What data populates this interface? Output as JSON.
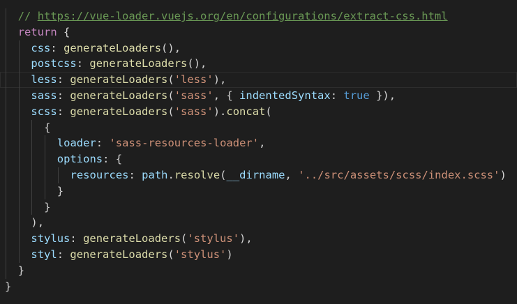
{
  "editor": {
    "lines": [
      {
        "indent": 1,
        "current": false,
        "tokens": [
          {
            "t": "// ",
            "c": "comment"
          },
          {
            "t": "https://vue-loader.vuejs.org/en/configurations/extract-css.html",
            "c": "link"
          }
        ]
      },
      {
        "indent": 1,
        "current": false,
        "tokens": [
          {
            "t": "return",
            "c": "keyword"
          },
          {
            "t": " {",
            "c": "punc"
          }
        ]
      },
      {
        "indent": 2,
        "current": false,
        "tokens": [
          {
            "t": "css",
            "c": "prop"
          },
          {
            "t": ": ",
            "c": "punc"
          },
          {
            "t": "generateLoaders",
            "c": "func"
          },
          {
            "t": "(),",
            "c": "punc"
          }
        ]
      },
      {
        "indent": 2,
        "current": false,
        "tokens": [
          {
            "t": "postcss",
            "c": "prop"
          },
          {
            "t": ": ",
            "c": "punc"
          },
          {
            "t": "generateLoaders",
            "c": "func"
          },
          {
            "t": "(),",
            "c": "punc"
          }
        ]
      },
      {
        "indent": 2,
        "current": true,
        "tokens": [
          {
            "t": "less",
            "c": "prop"
          },
          {
            "t": ": ",
            "c": "punc"
          },
          {
            "t": "generateLoaders",
            "c": "func"
          },
          {
            "t": "(",
            "c": "punc"
          },
          {
            "t": "'less'",
            "c": "string"
          },
          {
            "t": "),",
            "c": "punc"
          }
        ]
      },
      {
        "indent": 2,
        "current": false,
        "tokens": [
          {
            "t": "sass",
            "c": "prop"
          },
          {
            "t": ": ",
            "c": "punc"
          },
          {
            "t": "generateLoaders",
            "c": "func"
          },
          {
            "t": "(",
            "c": "punc"
          },
          {
            "t": "'sass'",
            "c": "string"
          },
          {
            "t": ", { ",
            "c": "punc"
          },
          {
            "t": "indentedSyntax",
            "c": "prop"
          },
          {
            "t": ": ",
            "c": "punc"
          },
          {
            "t": "true",
            "c": "bool"
          },
          {
            "t": " }),",
            "c": "punc"
          }
        ]
      },
      {
        "indent": 2,
        "current": false,
        "tokens": [
          {
            "t": "scss",
            "c": "prop"
          },
          {
            "t": ": ",
            "c": "punc"
          },
          {
            "t": "generateLoaders",
            "c": "func"
          },
          {
            "t": "(",
            "c": "punc"
          },
          {
            "t": "'sass'",
            "c": "string"
          },
          {
            "t": ").",
            "c": "punc"
          },
          {
            "t": "concat",
            "c": "func"
          },
          {
            "t": "(",
            "c": "punc"
          }
        ]
      },
      {
        "indent": 3,
        "current": false,
        "tokens": [
          {
            "t": "{",
            "c": "punc"
          }
        ]
      },
      {
        "indent": 4,
        "current": false,
        "tokens": [
          {
            "t": "loader",
            "c": "prop"
          },
          {
            "t": ": ",
            "c": "punc"
          },
          {
            "t": "'sass-resources-loader'",
            "c": "string"
          },
          {
            "t": ",",
            "c": "punc"
          }
        ]
      },
      {
        "indent": 4,
        "current": false,
        "tokens": [
          {
            "t": "options",
            "c": "prop"
          },
          {
            "t": ": {",
            "c": "punc"
          }
        ]
      },
      {
        "indent": 5,
        "current": false,
        "tokens": [
          {
            "t": "resources",
            "c": "prop"
          },
          {
            "t": ": ",
            "c": "punc"
          },
          {
            "t": "path",
            "c": "var"
          },
          {
            "t": ".",
            "c": "punc"
          },
          {
            "t": "resolve",
            "c": "func"
          },
          {
            "t": "(",
            "c": "punc"
          },
          {
            "t": "__dirname",
            "c": "var"
          },
          {
            "t": ", ",
            "c": "punc"
          },
          {
            "t": "'../src/assets/scss/index.scss'",
            "c": "string"
          },
          {
            "t": ")",
            "c": "punc"
          }
        ]
      },
      {
        "indent": 4,
        "current": false,
        "tokens": [
          {
            "t": "}",
            "c": "punc"
          }
        ]
      },
      {
        "indent": 3,
        "current": false,
        "tokens": [
          {
            "t": "}",
            "c": "punc"
          }
        ]
      },
      {
        "indent": 2,
        "current": false,
        "tokens": [
          {
            "t": "),",
            "c": "punc"
          }
        ]
      },
      {
        "indent": 2,
        "current": false,
        "tokens": [
          {
            "t": "stylus",
            "c": "prop"
          },
          {
            "t": ": ",
            "c": "punc"
          },
          {
            "t": "generateLoaders",
            "c": "func"
          },
          {
            "t": "(",
            "c": "punc"
          },
          {
            "t": "'stylus'",
            "c": "string"
          },
          {
            "t": "),",
            "c": "punc"
          }
        ]
      },
      {
        "indent": 2,
        "current": false,
        "tokens": [
          {
            "t": "styl",
            "c": "prop"
          },
          {
            "t": ": ",
            "c": "punc"
          },
          {
            "t": "generateLoaders",
            "c": "func"
          },
          {
            "t": "(",
            "c": "punc"
          },
          {
            "t": "'stylus'",
            "c": "string"
          },
          {
            "t": ")",
            "c": "punc"
          }
        ]
      },
      {
        "indent": 1,
        "current": false,
        "tokens": [
          {
            "t": "}",
            "c": "punc"
          }
        ]
      },
      {
        "indent": 0,
        "current": false,
        "tokens": [
          {
            "t": "}",
            "c": "punc"
          }
        ]
      }
    ]
  }
}
